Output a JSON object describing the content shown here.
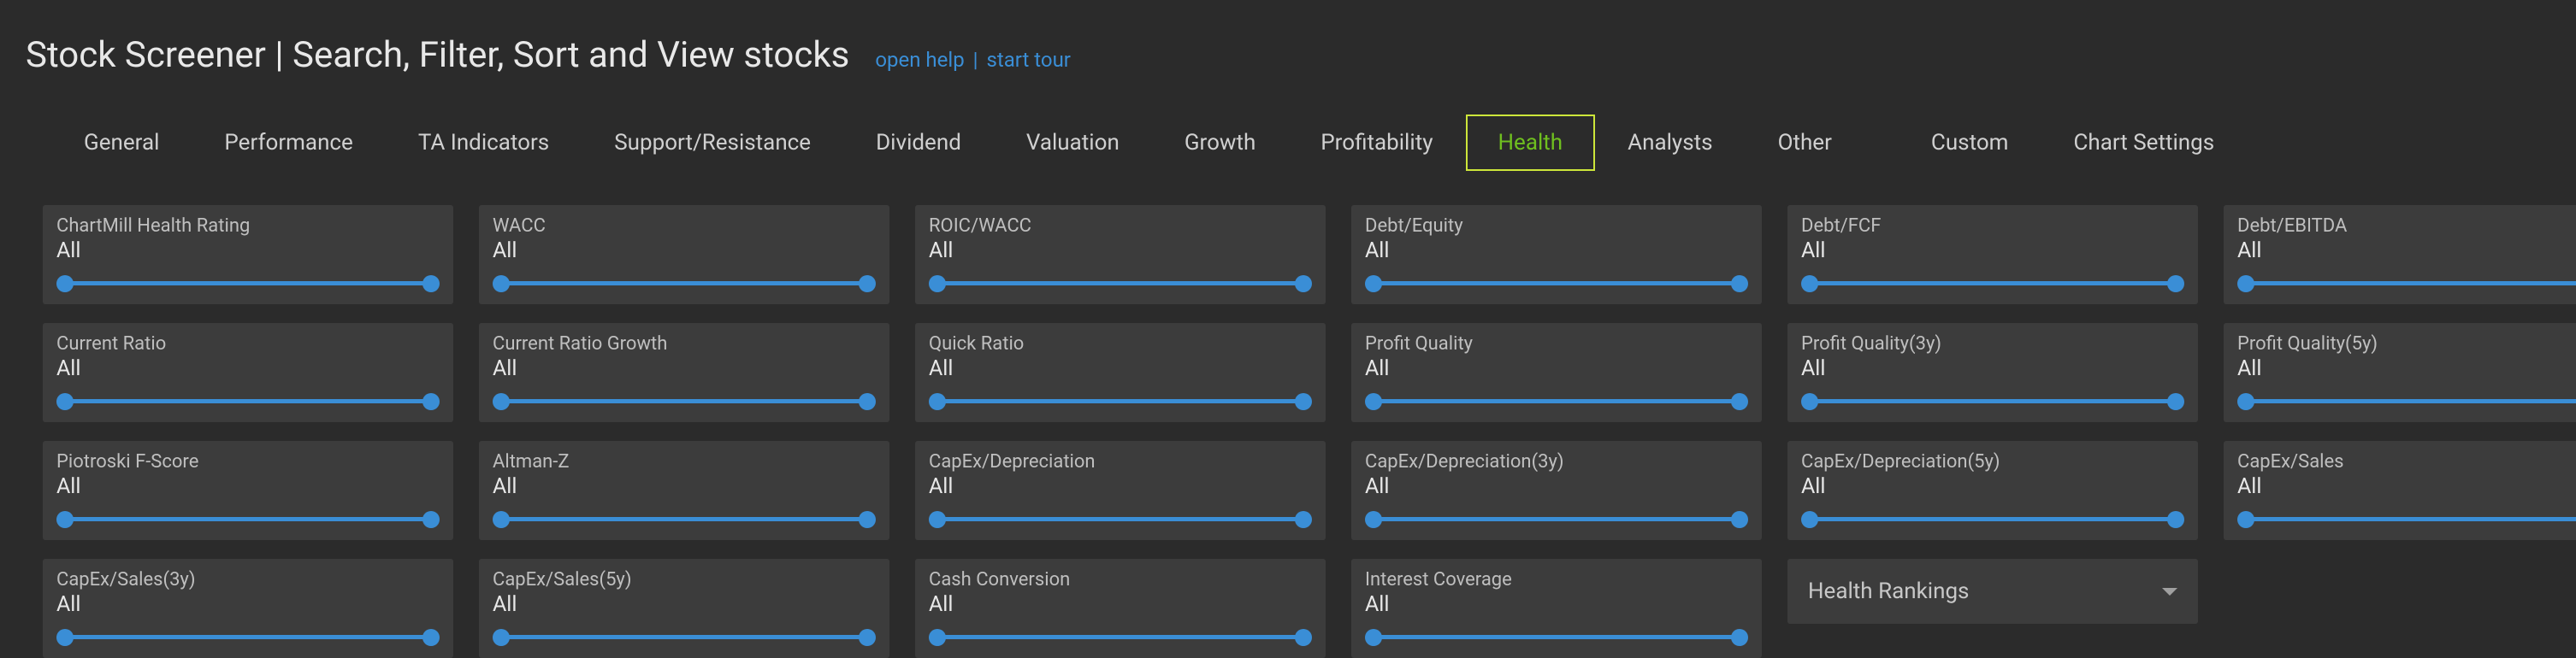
{
  "header": {
    "title": "Stock Screener | Search, Filter, Sort and View stocks",
    "open_help": "open help",
    "sep": "|",
    "start_tour": "start tour"
  },
  "tabs": [
    {
      "id": "general",
      "label": "General",
      "active": false
    },
    {
      "id": "performance",
      "label": "Performance",
      "active": false
    },
    {
      "id": "ta-indicators",
      "label": "TA Indicators",
      "active": false
    },
    {
      "id": "support-resistance",
      "label": "Support/Resistance",
      "active": false
    },
    {
      "id": "dividend",
      "label": "Dividend",
      "active": false
    },
    {
      "id": "valuation",
      "label": "Valuation",
      "active": false
    },
    {
      "id": "growth",
      "label": "Growth",
      "active": false
    },
    {
      "id": "profitability",
      "label": "Profitability",
      "active": false
    },
    {
      "id": "health",
      "label": "Health",
      "active": true
    },
    {
      "id": "analysts",
      "label": "Analysts",
      "active": false
    },
    {
      "id": "other",
      "label": "Other",
      "active": false
    },
    {
      "id": "custom",
      "label": "Custom",
      "active": false
    },
    {
      "id": "chart-settings",
      "label": "Chart Settings",
      "active": false
    }
  ],
  "filters": [
    {
      "id": "chartmill-health-rating",
      "label": "ChartMill Health Rating",
      "value": "All"
    },
    {
      "id": "wacc",
      "label": "WACC",
      "value": "All"
    },
    {
      "id": "roic-wacc",
      "label": "ROIC/WACC",
      "value": "All"
    },
    {
      "id": "debt-equity",
      "label": "Debt/Equity",
      "value": "All"
    },
    {
      "id": "debt-fcf",
      "label": "Debt/FCF",
      "value": "All"
    },
    {
      "id": "debt-ebitda",
      "label": "Debt/EBITDA",
      "value": "All"
    },
    {
      "id": "current-ratio",
      "label": "Current Ratio",
      "value": "All"
    },
    {
      "id": "current-ratio-growth",
      "label": "Current Ratio Growth",
      "value": "All"
    },
    {
      "id": "quick-ratio",
      "label": "Quick Ratio",
      "value": "All"
    },
    {
      "id": "profit-quality",
      "label": "Profit Quality",
      "value": "All"
    },
    {
      "id": "profit-quality-3y",
      "label": "Profit Quality(3y)",
      "value": "All"
    },
    {
      "id": "profit-quality-5y",
      "label": "Profit Quality(5y)",
      "value": "All"
    },
    {
      "id": "piotroski-f-score",
      "label": "Piotroski F-Score",
      "value": "All"
    },
    {
      "id": "altman-z",
      "label": "Altman-Z",
      "value": "All"
    },
    {
      "id": "capex-depreciation",
      "label": "CapEx/Depreciation",
      "value": "All"
    },
    {
      "id": "capex-depreciation-3y",
      "label": "CapEx/Depreciation(3y)",
      "value": "All"
    },
    {
      "id": "capex-depreciation-5y",
      "label": "CapEx/Depreciation(5y)",
      "value": "All"
    },
    {
      "id": "capex-sales",
      "label": "CapEx/Sales",
      "value": "All"
    },
    {
      "id": "capex-sales-3y",
      "label": "CapEx/Sales(3y)",
      "value": "All"
    },
    {
      "id": "capex-sales-5y",
      "label": "CapEx/Sales(5y)",
      "value": "All"
    },
    {
      "id": "cash-conversion",
      "label": "Cash Conversion",
      "value": "All"
    },
    {
      "id": "interest-coverage",
      "label": "Interest Coverage",
      "value": "All"
    }
  ],
  "dropdown": {
    "label": "Health Rankings"
  }
}
